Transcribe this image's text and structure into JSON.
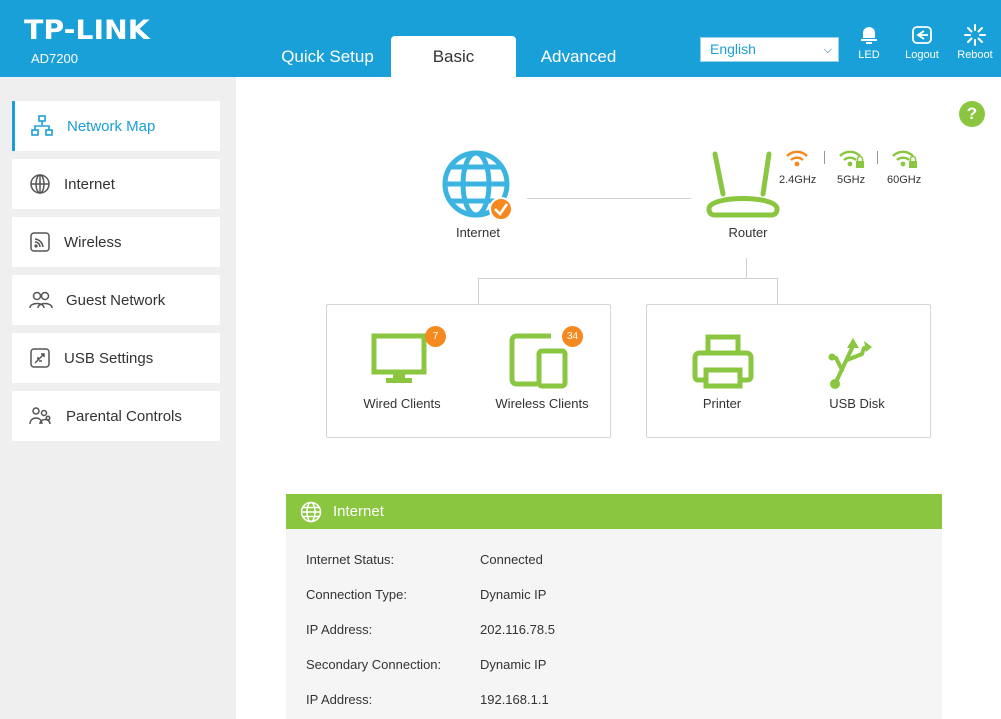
{
  "header": {
    "brand": "TP-LINK",
    "model": "AD7200",
    "tabs": [
      {
        "label": "Quick Setup",
        "active": false
      },
      {
        "label": "Basic",
        "active": true
      },
      {
        "label": "Advanced",
        "active": false
      }
    ],
    "language": "English",
    "actions": [
      {
        "label": "LED",
        "icon": "bulb-icon"
      },
      {
        "label": "Logout",
        "icon": "logout-icon"
      },
      {
        "label": "Reboot",
        "icon": "reboot-icon"
      }
    ]
  },
  "sidebar": {
    "items": [
      {
        "label": "Network Map",
        "icon": "network-map-icon",
        "active": true
      },
      {
        "label": "Internet",
        "icon": "globe-icon",
        "active": false
      },
      {
        "label": "Wireless",
        "icon": "wireless-icon",
        "active": false
      },
      {
        "label": "Guest Network",
        "icon": "guest-icon",
        "active": false
      },
      {
        "label": "USB Settings",
        "icon": "usb-settings-icon",
        "active": false
      },
      {
        "label": "Parental Controls",
        "icon": "parental-icon",
        "active": false
      }
    ]
  },
  "help": "?",
  "map": {
    "internet_label": "Internet",
    "router_label": "Router",
    "bands": [
      "2.4GHz",
      "5GHz",
      "60GHz"
    ],
    "devices": {
      "wired": {
        "label": "Wired Clients",
        "count": "7"
      },
      "wireless": {
        "label": "Wireless Clients",
        "count": "34"
      },
      "printer": {
        "label": "Printer"
      },
      "usb": {
        "label": "USB Disk"
      }
    }
  },
  "internet_panel": {
    "title": "Internet",
    "rows": [
      {
        "key": "Internet Status:",
        "value": "Connected"
      },
      {
        "key": "Connection Type:",
        "value": "Dynamic IP"
      },
      {
        "key": "IP Address:",
        "value": "202.116.78.5"
      },
      {
        "key": "Secondary Connection:",
        "value": "Dynamic IP"
      },
      {
        "key": "IP Address:",
        "value": "192.168.1.1"
      }
    ]
  },
  "colors": {
    "brand_blue": "#1aa0d8",
    "accent_green": "#8ac640",
    "badge_orange": "#f5891f",
    "sidebar_bg": "#efefef"
  }
}
